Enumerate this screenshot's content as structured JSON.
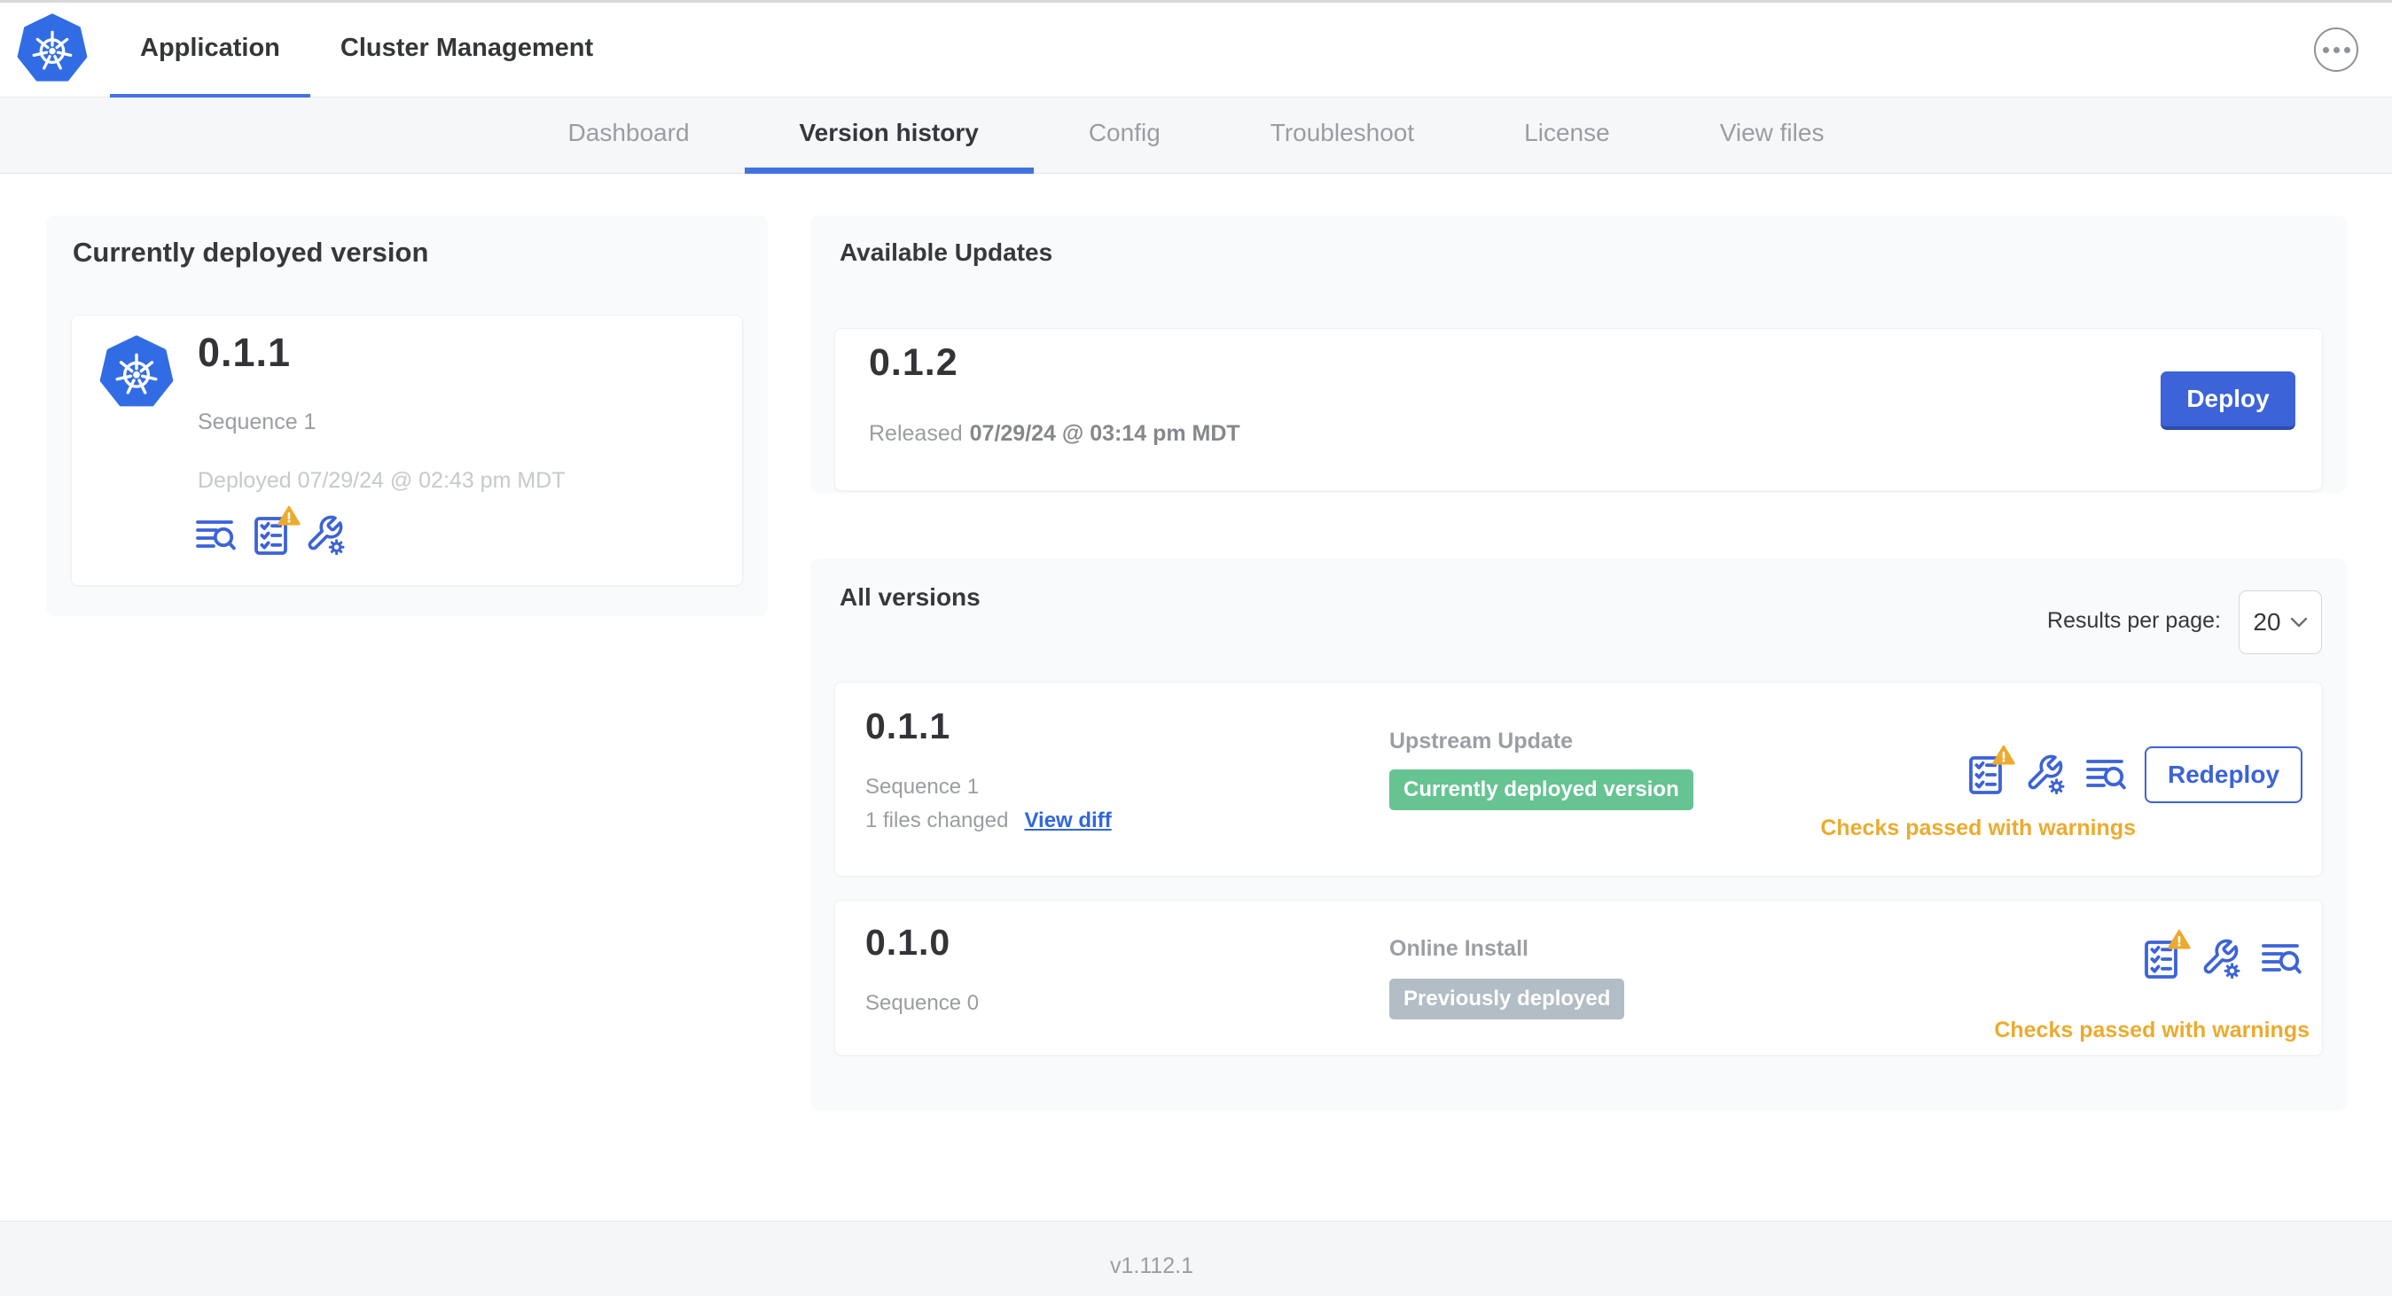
{
  "header": {
    "logo_icon": "kubernetes-logo",
    "overflow_icon": "ellipsis-icon",
    "tabs": [
      {
        "label": "Application",
        "active": true
      },
      {
        "label": "Cluster Management",
        "active": false
      }
    ]
  },
  "subnav": {
    "tabs": [
      {
        "label": "Dashboard",
        "active": false
      },
      {
        "label": "Version history",
        "active": true
      },
      {
        "label": "Config",
        "active": false
      },
      {
        "label": "Troubleshoot",
        "active": false
      },
      {
        "label": "License",
        "active": false
      },
      {
        "label": "View files",
        "active": false
      }
    ]
  },
  "deployed_card": {
    "title": "Currently deployed version",
    "version": "0.1.1",
    "sequence": "Sequence 1",
    "deployed_at": "Deployed 07/29/24 @ 02:43 pm MDT",
    "icons": [
      "release-notes-icon",
      "preflight-checks-warning-icon",
      "config-icon"
    ]
  },
  "available_updates": {
    "title": "Available Updates",
    "update": {
      "version": "0.1.2",
      "released_label": "Released",
      "released_date": "07/29/24 @ 03:14 pm MDT",
      "deploy_button": "Deploy"
    }
  },
  "all_versions": {
    "title": "All versions",
    "results_per_page_label": "Results per page:",
    "results_per_page": "20",
    "rows": [
      {
        "version": "0.1.1",
        "sequence": "Sequence 1",
        "files_changed": "1 files changed",
        "view_diff_link": "View diff",
        "source": "Upstream Update",
        "status_badge": "Currently deployed version",
        "action_button": "Redeploy",
        "check_status": "Checks passed with warnings",
        "icons": [
          "preflight-checks-warning-icon",
          "config-icon",
          "release-notes-icon"
        ]
      },
      {
        "version": "0.1.0",
        "sequence": "Sequence 0",
        "source": "Online Install",
        "status_badge": "Previously deployed",
        "check_status": "Checks passed with warnings",
        "icons": [
          "preflight-checks-warning-icon",
          "config-icon",
          "release-notes-icon"
        ]
      }
    ]
  },
  "footer": {
    "app_version": "v1.112.1"
  },
  "colors": {
    "accent_blue": "#3C63D8",
    "k8s_blue": "#326CE5",
    "badge_green": "#66C392",
    "badge_gray": "#B3BDC5",
    "warning_amber": "#ECAB2E",
    "link_blue": "#3066E0"
  }
}
